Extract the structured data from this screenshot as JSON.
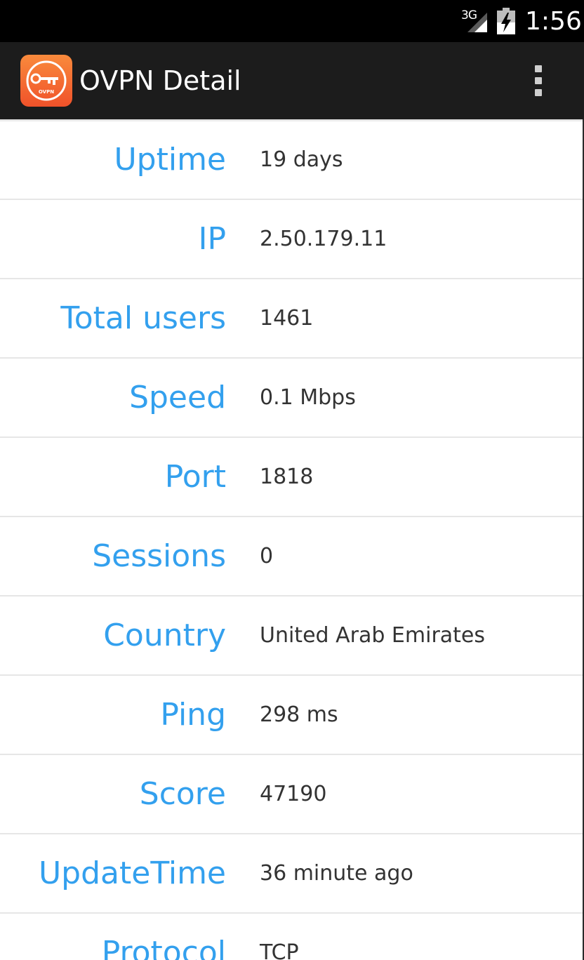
{
  "status_bar": {
    "network": "3G",
    "time": "1:56",
    "signal_icon": "signal-icon",
    "battery_icon": "battery-charging-icon"
  },
  "action_bar": {
    "title": "OVPN Detail",
    "app_icon": "key-icon",
    "overflow_icon": "overflow-menu-icon",
    "app_icon_text": "OVPN"
  },
  "colors": {
    "label": "#33a0ee",
    "value": "#333333",
    "app_icon": "#f26a2a",
    "action_bar": "#1c1c1c"
  },
  "details": [
    {
      "label": "Uptime",
      "value": "19 days"
    },
    {
      "label": "IP",
      "value": "2.50.179.11"
    },
    {
      "label": "Total users",
      "value": "1461"
    },
    {
      "label": "Speed",
      "value": "0.1 Mbps"
    },
    {
      "label": "Port",
      "value": "1818"
    },
    {
      "label": "Sessions",
      "value": "0"
    },
    {
      "label": "Country",
      "value": "United Arab Emirates"
    },
    {
      "label": "Ping",
      "value": "298 ms"
    },
    {
      "label": "Score",
      "value": "47190"
    },
    {
      "label": "UpdateTime",
      "value": "36 minute ago"
    },
    {
      "label": "Protocol",
      "value": "TCP"
    }
  ]
}
